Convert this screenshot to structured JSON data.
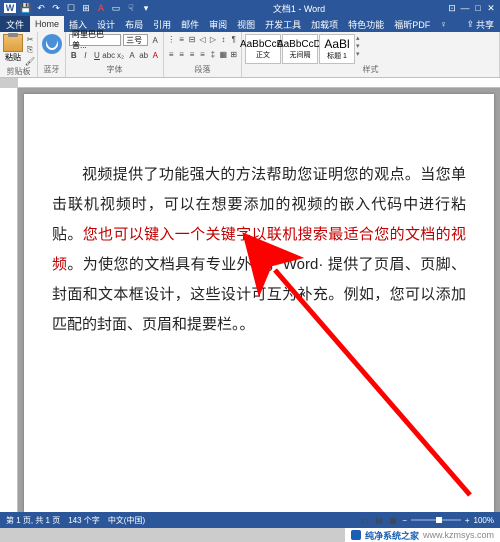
{
  "title": "文档1 - Word",
  "qat": [
    "save-icon",
    "undo-icon",
    "redo-icon",
    "folder-icon",
    "table-icon",
    "font-color-icon",
    "picture-icon",
    "hand-icon"
  ],
  "menu": {
    "file": "文件",
    "tabs": [
      "Home",
      "插入",
      "设计",
      "布局",
      "引用",
      "邮件",
      "审阅",
      "视图",
      "开发工具",
      "加载项",
      "特色功能",
      "福昕PDF"
    ],
    "tell": "♀",
    "share": "共享"
  },
  "ribbon": {
    "clipboard": {
      "paste": "粘贴",
      "label": "剪贴板"
    },
    "bluetooth": {
      "label": "蓝牙"
    },
    "font": {
      "family": "阿里巴巴普...",
      "size": "三号",
      "label": "字体"
    },
    "paragraph": {
      "label": "段落"
    },
    "styles": {
      "items": [
        {
          "prev": "AaBbCcDi",
          "name": "正文"
        },
        {
          "prev": "AaBbCcDi",
          "name": "无间隔"
        },
        {
          "prev": "AaBl",
          "name": "标题 1"
        }
      ],
      "label": "样式"
    }
  },
  "document": {
    "pre": "视频提供了功能强大的方法帮助您证明您的观点。当您单击联机视频时，可以在想要添加的视频的嵌入代码中进行粘贴。",
    "hl": "您也可以键入一个关键字以联机搜索最适合您的文档的视频",
    "post": "。为使您的文档具有专业外观，Word· 提供了页眉、页脚、封面和文本框设计，这些设计可互为补充。例如，您可以添加匹配的封面、页眉和提要栏。。"
  },
  "status": {
    "page": "第 1 页, 共 1 页",
    "words": "143 个字",
    "lang": "中文(中国)",
    "zoom": "100%"
  },
  "watermark": {
    "text": "纯净系统之家",
    "url": "www.kzmsys.com"
  }
}
